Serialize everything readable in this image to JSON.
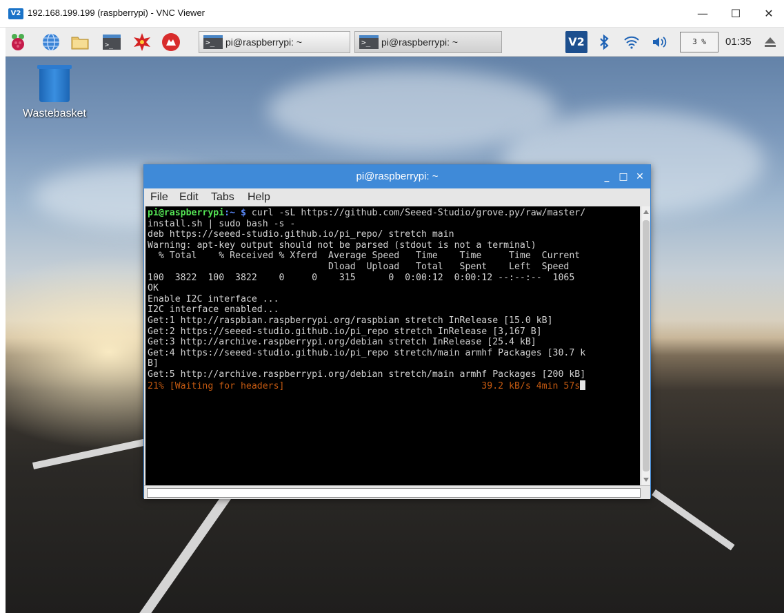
{
  "vnc": {
    "logo": "V2",
    "title": "192.168.199.199 (raspberrypi) - VNC Viewer",
    "controls": {
      "minimize": "—",
      "maximize": "☐",
      "close": "✕"
    }
  },
  "taskbar": {
    "launcher_icons": [
      "raspberry-menu-icon",
      "web-browser-icon",
      "file-manager-icon",
      "terminal-icon",
      "mathematica-icon",
      "wolfram-icon"
    ],
    "tasks": [
      {
        "label": "pi@raspberrypi: ~",
        "active": true
      },
      {
        "label": "pi@raspberrypi: ~",
        "active": false
      }
    ],
    "terminal_glyph": ">_",
    "tray": {
      "vnc": "V2",
      "cpu": "3 %",
      "clock": "01:35"
    }
  },
  "desktop": {
    "icons": [
      {
        "label": "Wastebasket",
        "icon": "wastebasket-icon"
      }
    ]
  },
  "terminal": {
    "title": "pi@raspberrypi: ~",
    "buttons": {
      "minimize": "_",
      "maximize": "□",
      "close": "✕"
    },
    "menu": [
      "File",
      "Edit",
      "Tabs",
      "Help"
    ],
    "prompt_user": "pi@raspberrypi",
    "prompt_path": ":~ $",
    "command": " curl -sL https://github.com/Seeed-Studio/grove.py/raw/master/",
    "lines": [
      "install.sh | sudo bash -s -",
      "deb https://seeed-studio.github.io/pi_repo/ stretch main",
      "Warning: apt-key output should not be parsed (stdout is not a terminal)",
      "  % Total    % Received % Xferd  Average Speed   Time    Time     Time  Current",
      "                                 Dload  Upload   Total   Spent    Left  Speed",
      "100  3822  100  3822    0     0    315      0  0:00:12  0:00:12 --:--:--  1065",
      "OK",
      "Enable I2C interface ...",
      "I2C interface enabled...",
      "Get:1 http://raspbian.raspberrypi.org/raspbian stretch InRelease [15.0 kB]",
      "Get:2 https://seeed-studio.github.io/pi_repo stretch InRelease [3,167 B]",
      "Get:3 http://archive.raspberrypi.org/debian stretch InRelease [25.4 kB]",
      "Get:4 https://seeed-studio.github.io/pi_repo stretch/main armhf Packages [30.7 k",
      "B]",
      "Get:5 http://archive.raspberrypi.org/debian stretch/main armhf Packages [200 kB]"
    ],
    "progress_line": "21% [Waiting for headers]                                    39.2 kB/s 4min 57s"
  },
  "colors": {
    "titlebar_blue": "#3f8ad8",
    "prompt_green": "#55e655",
    "prompt_blue": "#5c8cff",
    "progress_orange": "#c55a11"
  }
}
